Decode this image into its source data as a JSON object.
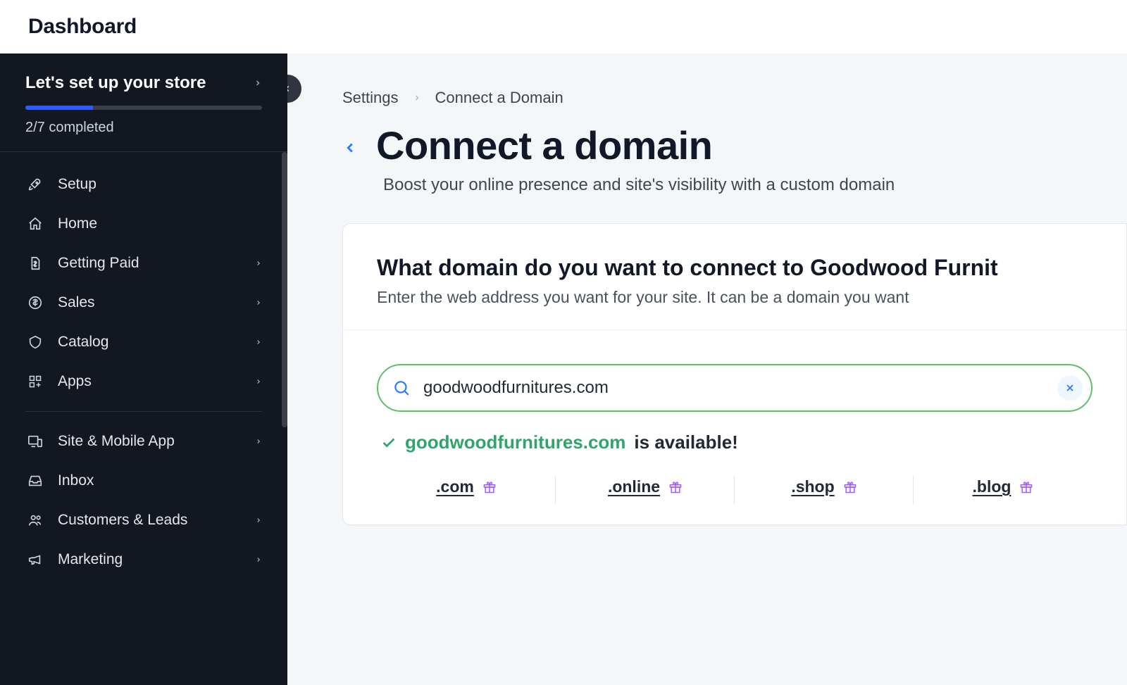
{
  "topbar": {
    "title": "Dashboard"
  },
  "sidebar": {
    "setup": {
      "title": "Let's set up your store",
      "progress_text": "2/7 completed",
      "progress_pct": 28.57
    },
    "items": [
      {
        "label": "Setup",
        "icon": "rocket-icon",
        "has_children": false
      },
      {
        "label": "Home",
        "icon": "home-icon",
        "has_children": false
      },
      {
        "label": "Getting Paid",
        "icon": "paid-icon",
        "has_children": true
      },
      {
        "label": "Sales",
        "icon": "sales-icon",
        "has_children": true
      },
      {
        "label": "Catalog",
        "icon": "catalog-icon",
        "has_children": true
      },
      {
        "label": "Apps",
        "icon": "apps-icon",
        "has_children": true
      }
    ],
    "items2": [
      {
        "label": "Site & Mobile App",
        "icon": "devices-icon",
        "has_children": true
      },
      {
        "label": "Inbox",
        "icon": "inbox-icon",
        "has_children": false
      },
      {
        "label": "Customers & Leads",
        "icon": "customers-icon",
        "has_children": true
      },
      {
        "label": "Marketing",
        "icon": "marketing-icon",
        "has_children": true
      }
    ]
  },
  "breadcrumb": {
    "root": "Settings",
    "current": "Connect a Domain"
  },
  "page": {
    "title": "Connect a domain",
    "subtitle": "Boost your online presence and site's visibility with a custom domain"
  },
  "card": {
    "title": "What domain do you want to connect to Goodwood Furnit",
    "subtitle": "Enter the web address you want for your site. It can be a domain you want",
    "input_value": "goodwoodfurnitures.com",
    "avail_domain": "goodwoodfurnitures.com",
    "avail_text": "is available!",
    "tlds": [
      ".com",
      ".online",
      ".shop",
      ".blog"
    ]
  }
}
